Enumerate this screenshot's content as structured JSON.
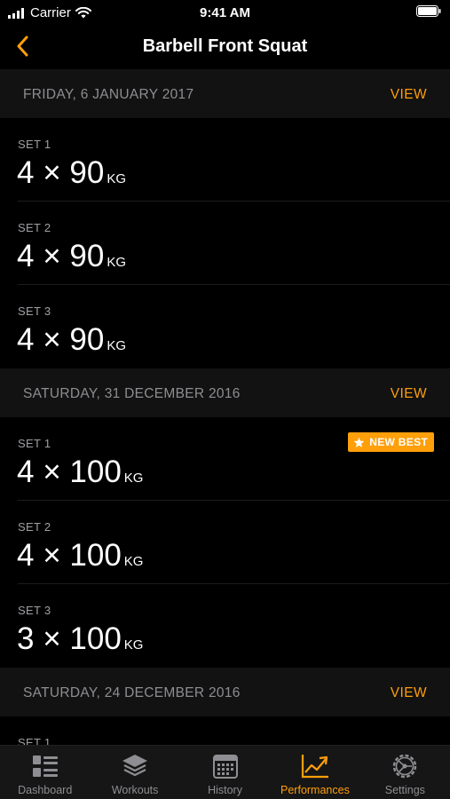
{
  "status_bar": {
    "carrier": "Carrier",
    "time": "9:41 AM"
  },
  "nav": {
    "title": "Barbell Front Squat",
    "back_icon": "chevron-left-icon"
  },
  "sessions": [
    {
      "date": "FRIDAY, 6 JANUARY 2017",
      "view_label": "VIEW",
      "sets": [
        {
          "label": "SET 1",
          "reps": "4",
          "times": "×",
          "weight": "90",
          "unit": "KG",
          "badge": ""
        },
        {
          "label": "SET 2",
          "reps": "4",
          "times": "×",
          "weight": "90",
          "unit": "KG",
          "badge": ""
        },
        {
          "label": "SET 3",
          "reps": "4",
          "times": "×",
          "weight": "90",
          "unit": "KG",
          "badge": ""
        }
      ]
    },
    {
      "date": "SATURDAY, 31 DECEMBER 2016",
      "view_label": "VIEW",
      "sets": [
        {
          "label": "SET 1",
          "reps": "4",
          "times": "×",
          "weight": "100",
          "unit": "KG",
          "badge": "NEW BEST"
        },
        {
          "label": "SET 2",
          "reps": "4",
          "times": "×",
          "weight": "100",
          "unit": "KG",
          "badge": ""
        },
        {
          "label": "SET 3",
          "reps": "3",
          "times": "×",
          "weight": "100",
          "unit": "KG",
          "badge": ""
        }
      ]
    },
    {
      "date": "SATURDAY, 24 DECEMBER 2016",
      "view_label": "VIEW",
      "sets": [
        {
          "label": "SET 1",
          "reps": "",
          "times": "",
          "weight": "",
          "unit": "",
          "badge": ""
        }
      ]
    }
  ],
  "tab_bar": {
    "active": "Performances",
    "tabs": [
      {
        "label": "Dashboard",
        "icon": "dashboard-list-icon"
      },
      {
        "label": "Workouts",
        "icon": "stacked-layers-icon"
      },
      {
        "label": "History",
        "icon": "calendar-icon"
      },
      {
        "label": "Performances",
        "icon": "trend-chart-icon"
      },
      {
        "label": "Settings",
        "icon": "gear-icon"
      }
    ]
  },
  "colors": {
    "accent": "#ff9f0a",
    "background": "#000000",
    "section_header": "#121212",
    "secondary_text": "#8e8e93",
    "tab_bar": "#161616"
  }
}
